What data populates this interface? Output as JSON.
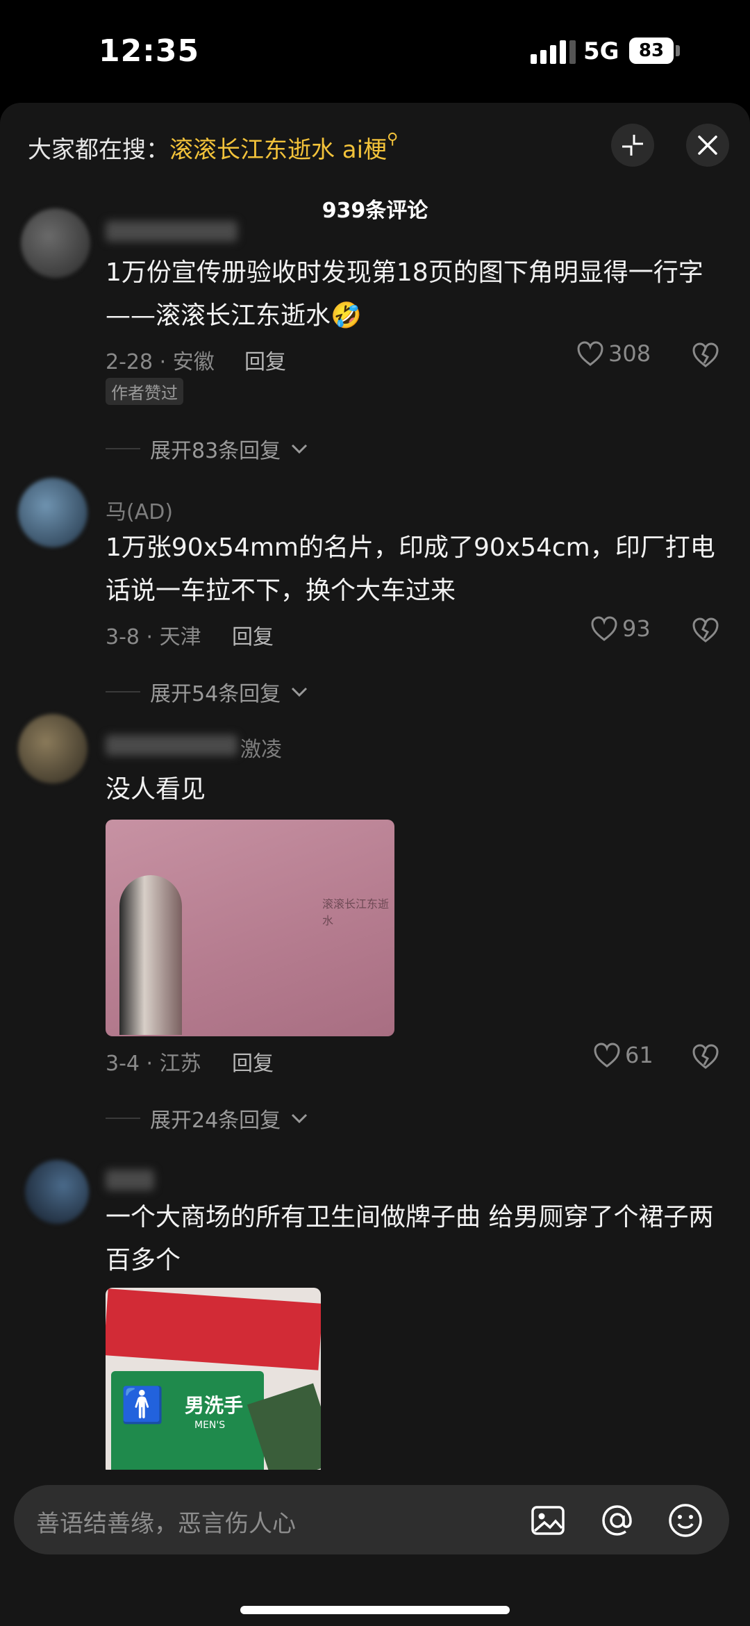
{
  "status": {
    "time": "12:35",
    "network": "5G",
    "battery": "83"
  },
  "header": {
    "search_prefix": "大家都在搜：",
    "search_keyword": "滚滚长江东逝水 ai梗",
    "comment_count": "939条评论"
  },
  "comments": [
    {
      "username": "",
      "text": "1万份宣传册验收时发现第18页的图下角明显得一行字——滚滚长江东逝水🤣",
      "meta": "2-28 · 安徽",
      "reply_label": "回复",
      "likes": "308",
      "badge": "作者赞过",
      "expand": "展开83条回复"
    },
    {
      "username": "马(AD)",
      "text": "1万张90x54mm的名片，印成了90x54cm，印厂打电话说一车拉不下，换个大车过来",
      "meta": "3-8 · 天津",
      "reply_label": "回复",
      "likes": "93",
      "expand": "展开54条回复"
    },
    {
      "username": "激凌",
      "text": "没人看见",
      "image_caption": "滚滚长江东逝水",
      "meta": "3-4 · 江苏",
      "reply_label": "回复",
      "likes": "61",
      "expand": "展开24条回复"
    },
    {
      "username": "",
      "text": "一个大商场的所有卫生间做牌子曲 给男厕穿了个裙子两百多个",
      "sign_text": "男洗手",
      "sign_sub": "MEN'S"
    }
  ],
  "input": {
    "placeholder": "善语结善缘，恶言伤人心"
  },
  "colors": {
    "accent": "#f2c23a",
    "background": "#161616",
    "meta": "#8a8a8a"
  },
  "icons": [
    "collapse-icon",
    "close-icon",
    "heart-icon",
    "broken-heart-icon",
    "image-icon",
    "at-icon",
    "emoji-icon"
  ]
}
